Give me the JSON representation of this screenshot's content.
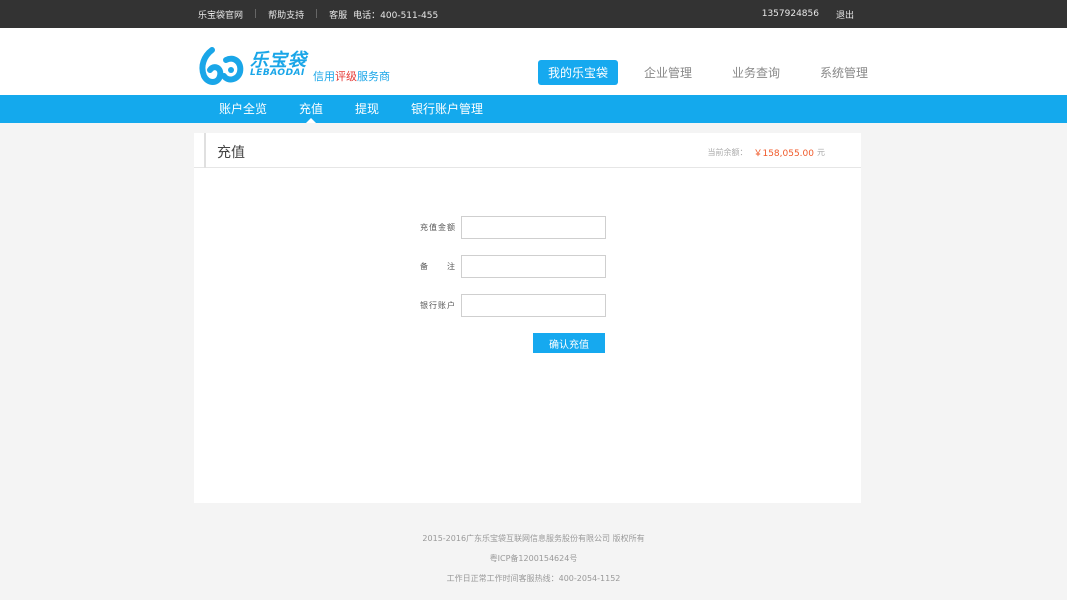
{
  "topbar": {
    "links": [
      "乐宝袋官网",
      "帮助支持",
      "客服"
    ],
    "phone": "电话：400-511-455",
    "account": "1357924856",
    "logout": "退出"
  },
  "logo": {
    "cn": "乐宝袋",
    "en": "LEBAODAI",
    "slogan_a": "信用",
    "slogan_b": "评级",
    "slogan_c": "服务商"
  },
  "mainnav": [
    "我的乐宝袋",
    "企业管理",
    "业务查询",
    "系统管理"
  ],
  "subnav": [
    "账户全览",
    "充值",
    "提现",
    "银行账户管理"
  ],
  "panel": {
    "title": "充值",
    "balance_label": "当前余额：",
    "balance_amount": "￥158,055.00",
    "balance_unit": "元"
  },
  "form": {
    "amount_label": "充值金额",
    "amount_value": "",
    "note_label": "备　注",
    "note_value": "",
    "bank_label": "银行账户",
    "bank_value": "",
    "submit": "确认充值"
  },
  "footer": {
    "copyright": "2015-2016广东乐宝袋互联网信息服务股份有限公司 版权所有",
    "icp": "粤ICP备1200154624号",
    "hotline": "工作日正常工作时间客服热线：400-2054-1152"
  },
  "colors": {
    "accent": "#14a9ed",
    "topbar": "#333333",
    "amount": "#f05a2a"
  }
}
